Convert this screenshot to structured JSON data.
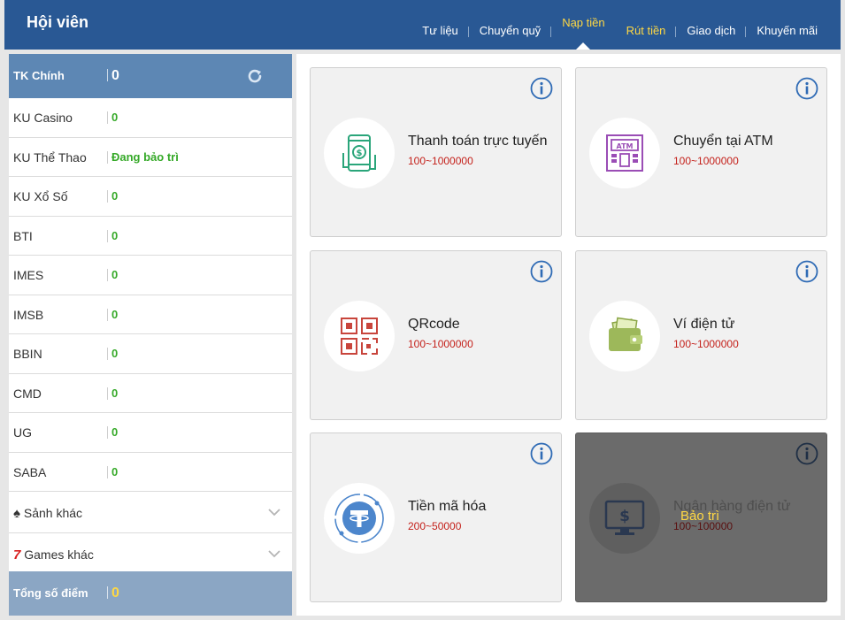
{
  "header": {
    "title": "Hội viên",
    "nav": [
      {
        "label": "Tư liệu"
      },
      {
        "label": "Chuyển quỹ"
      },
      {
        "label": "Nạp tiền"
      },
      {
        "label": "Rút tiền"
      },
      {
        "label": "Giao dịch"
      },
      {
        "label": "Khuyến mãi"
      }
    ]
  },
  "sidebar": {
    "main_account": {
      "label": "TK Chính",
      "value": "0"
    },
    "rows": [
      {
        "label": "KU Casino",
        "value": "0"
      },
      {
        "label": "KU Thể Thao",
        "value": "Đang bảo trì"
      },
      {
        "label": "KU Xổ Số",
        "value": "0"
      },
      {
        "label": "BTI",
        "value": "0"
      },
      {
        "label": "IMES",
        "value": "0"
      },
      {
        "label": "IMSB",
        "value": "0"
      },
      {
        "label": "BBIN",
        "value": "0"
      },
      {
        "label": "CMD",
        "value": "0"
      },
      {
        "label": "UG",
        "value": "0"
      },
      {
        "label": "SABA",
        "value": "0"
      }
    ],
    "other_lobby": "Sảnh khác",
    "other_games": "Games khác",
    "total": {
      "label": "Tổng số điểm",
      "value": "0"
    }
  },
  "methods": [
    {
      "title": "Thanh toán trực tuyến",
      "range": "100~1000000",
      "icon": "phone-dollar-icon"
    },
    {
      "title": "Chuyển tại ATM",
      "range": "100~1000000",
      "icon": "atm-icon"
    },
    {
      "title": "QRcode",
      "range": "100~1000000",
      "icon": "qrcode-icon"
    },
    {
      "title": "Ví điện tử",
      "range": "100~1000000",
      "icon": "wallet-icon"
    },
    {
      "title": "Tiền mã hóa",
      "range": "200~50000",
      "icon": "tether-icon"
    },
    {
      "title": "Ngân hàng điện tử",
      "range": "100~100000",
      "icon": "monitor-dollar-icon",
      "status": "Bảo trì"
    }
  ],
  "colors": {
    "header_bg": "#295894",
    "active_nav": "#ffd843",
    "value_green": "#35a928",
    "range_red": "#c4211b"
  }
}
